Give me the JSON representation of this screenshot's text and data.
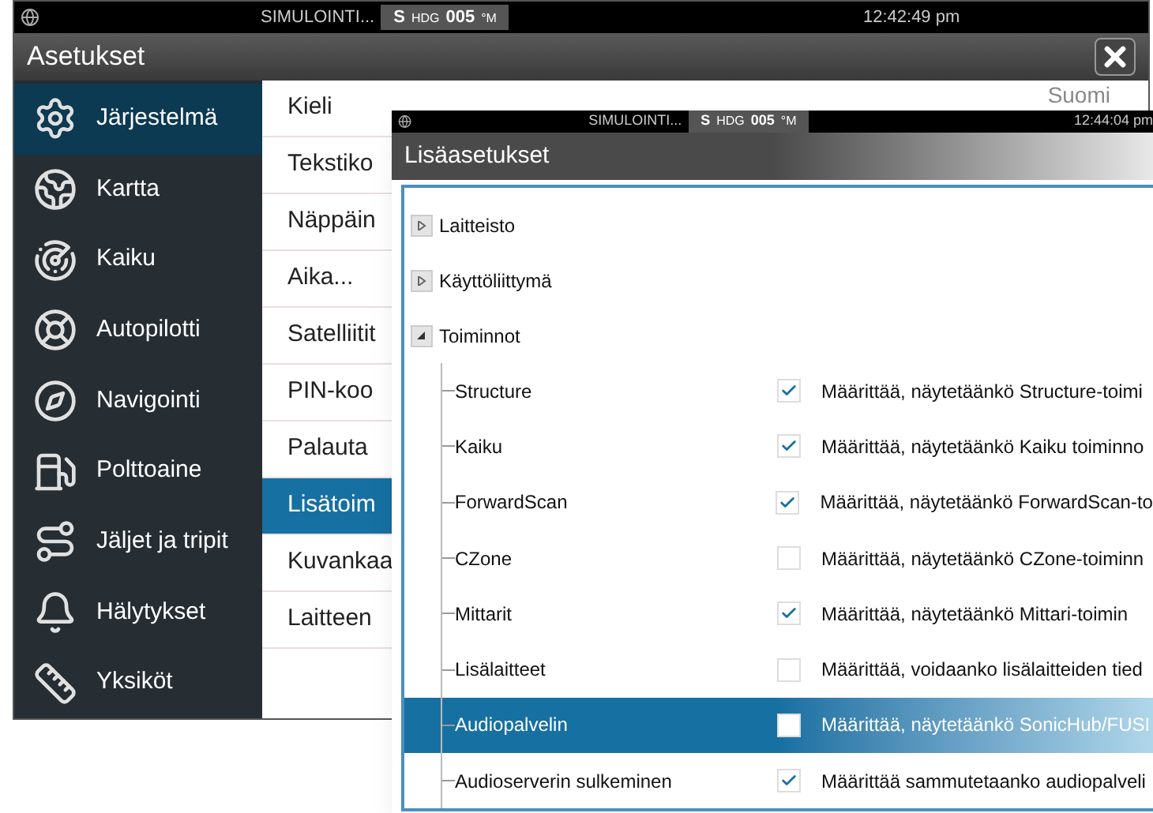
{
  "status_bar": {
    "mode": "SIMULOINTI...",
    "heading_prefix": "S",
    "heading_label": "HDG",
    "heading_value": "005",
    "heading_unit": "°M",
    "time": "12:42:49 pm"
  },
  "window": {
    "title": "Asetukset"
  },
  "sidebar": {
    "items": [
      {
        "label": "Järjestelmä",
        "selected": true
      },
      {
        "label": "Kartta",
        "selected": false
      },
      {
        "label": "Kaiku",
        "selected": false
      },
      {
        "label": "Autopilotti",
        "selected": false
      },
      {
        "label": "Navigointi",
        "selected": false
      },
      {
        "label": "Polttoaine",
        "selected": false
      },
      {
        "label": "Jäljet ja tripit",
        "selected": false
      },
      {
        "label": "Hälytykset",
        "selected": false
      },
      {
        "label": "Yksiköt",
        "selected": false
      }
    ]
  },
  "settings_list": {
    "items": [
      {
        "label": "Kieli",
        "value": "Suomi",
        "selected": false
      },
      {
        "label": "Tekstiko",
        "selected": false
      },
      {
        "label": "Näppäin",
        "selected": false
      },
      {
        "label": "Aika...",
        "selected": false
      },
      {
        "label": "Satelliitit",
        "selected": false
      },
      {
        "label": "PIN-koo",
        "selected": false
      },
      {
        "label": "Palauta",
        "selected": false
      },
      {
        "label": "Lisätoim",
        "selected": true
      },
      {
        "label": "Kuvankaa",
        "selected": false
      },
      {
        "label": "Laitteen",
        "selected": false
      }
    ]
  },
  "dialog": {
    "status_bar": {
      "mode": "SIMULOINTI...",
      "heading_prefix": "S",
      "heading_label": "HDG",
      "heading_value": "005",
      "heading_unit": "°M",
      "time": "12:44:04 pm"
    },
    "title": "Lisäasetukset",
    "tree": [
      {
        "label": "Laitteisto",
        "expanded": false
      },
      {
        "label": "Käyttöliittymä",
        "expanded": false
      },
      {
        "label": "Toiminnot",
        "expanded": true,
        "children": [
          {
            "label": "Structure",
            "checked": true,
            "description": "Määrittää, näytetäänkö Structure-toimi",
            "selected": false
          },
          {
            "label": "Kaiku",
            "checked": true,
            "description": "Määrittää, näytetäänkö Kaiku toiminno",
            "selected": false
          },
          {
            "label": "ForwardScan",
            "checked": true,
            "description": "Määrittää, näytetäänkö ForwardScan-to",
            "selected": false
          },
          {
            "label": "CZone",
            "checked": false,
            "description": "Määrittää, näytetäänkö CZone-toiminn",
            "selected": false
          },
          {
            "label": "Mittarit",
            "checked": true,
            "description": "Määrittää, näytetäänkö Mittari-toimin",
            "selected": false
          },
          {
            "label": "Lisälaitteet",
            "checked": false,
            "description": "Määrittää, voidaanko lisälaitteiden tied",
            "selected": false
          },
          {
            "label": "Audiopalvelin",
            "checked": false,
            "description": "Määrittää, näytetäänkö SonicHub/FUSI",
            "selected": true
          },
          {
            "label": "Audioserverin sulkeminen",
            "checked": true,
            "description": "Määrittää sammutetaanko audiopalveli",
            "selected": false
          }
        ]
      }
    ]
  }
}
